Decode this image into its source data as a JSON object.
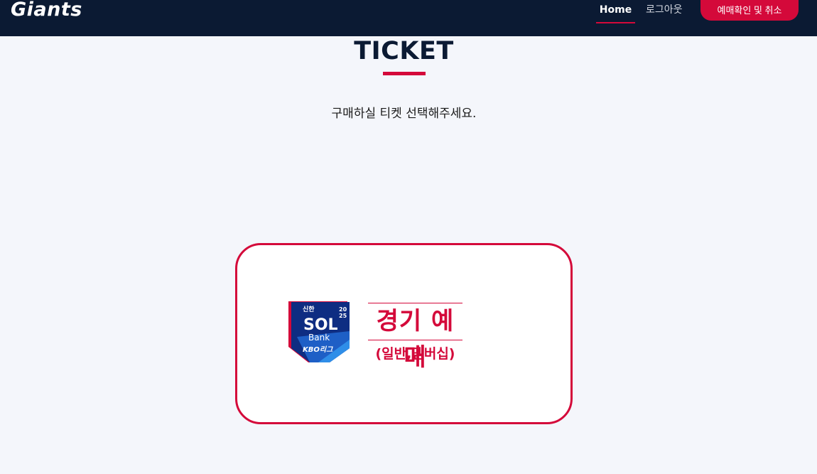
{
  "nav": {
    "logo": "Giants",
    "home": "Home",
    "logout": "로그아웃",
    "reserve": "예매확인 및 취소"
  },
  "main": {
    "title": "TICKET",
    "subtitle": "구매하실 티켓 선택해주세요."
  },
  "card": {
    "logo": {
      "sponsor": "신한",
      "year_top": "20",
      "year_bottom": "25",
      "brand": "SOL",
      "bank": "Bank",
      "league": "KBO리그"
    },
    "label": "경기 예매",
    "sublabel": "(일반,멤버십)"
  },
  "colors": {
    "navy": "#0b1a33",
    "accent": "#d4093a",
    "logo_blue": "#0e2d82",
    "background": "#f4f6fb"
  }
}
